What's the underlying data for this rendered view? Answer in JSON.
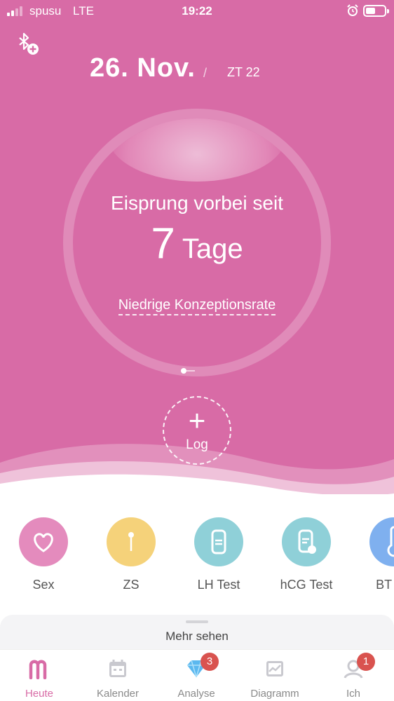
{
  "status_bar": {
    "carrier": "spusu",
    "network": "LTE",
    "time": "19:22"
  },
  "header": {
    "date": "26. Nov.",
    "separator": "/",
    "cycle_day": "ZT 22"
  },
  "ring": {
    "status": "Eisprung vorbei seit",
    "days_value": "7",
    "days_unit": "Tage",
    "rate_link": "Niedrige Konzeptionsrate"
  },
  "log_button": {
    "plus": "+",
    "label": "Log"
  },
  "actions": [
    {
      "label": "Sex",
      "color": "#e48bbd"
    },
    {
      "label": "ZS",
      "color": "#f5d27a"
    },
    {
      "label": "LH Test",
      "color": "#8fd0d8"
    },
    {
      "label": "hCG Test",
      "color": "#8fd0d8"
    },
    {
      "label": "BT hin",
      "color": "#7fb0ef"
    }
  ],
  "more": {
    "label": "Mehr sehen"
  },
  "tabs": [
    {
      "label": "Heute",
      "active": true
    },
    {
      "label": "Kalender"
    },
    {
      "label": "Analyse",
      "badge": "3"
    },
    {
      "label": "Diagramm"
    },
    {
      "label": "Ich",
      "badge": "1"
    }
  ],
  "colors": {
    "hero": "#d86ba6",
    "accent": "#d86ba6",
    "badge": "#d9534f"
  }
}
